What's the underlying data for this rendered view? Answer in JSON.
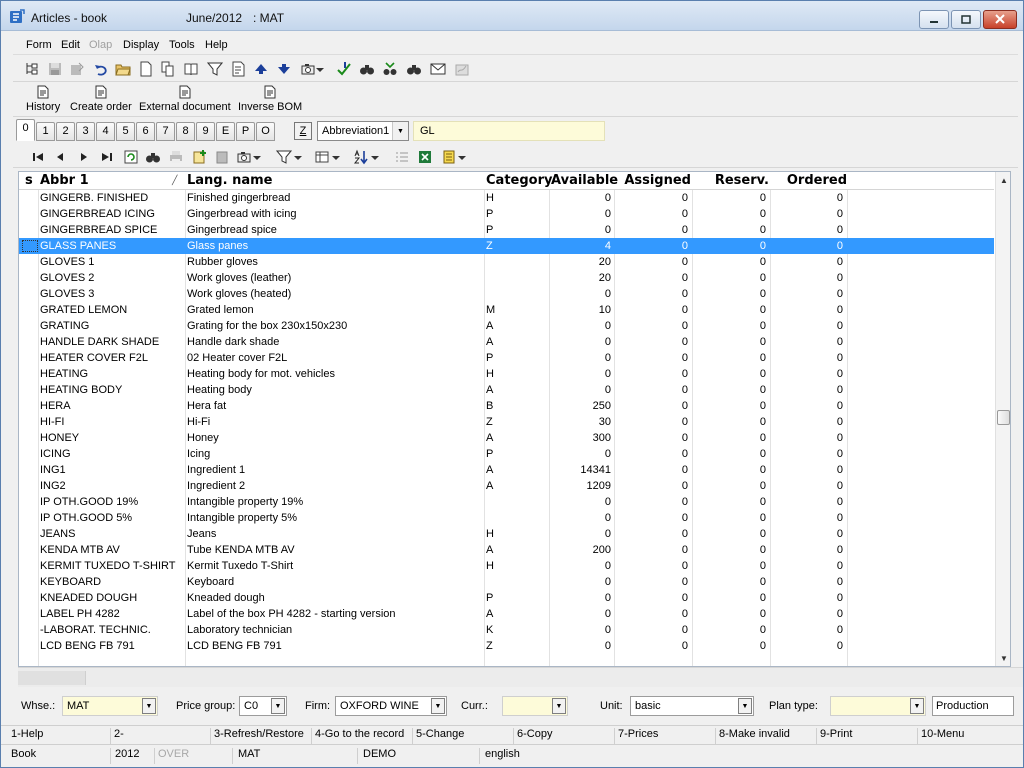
{
  "window": {
    "title": "Articles - book",
    "period": "June/2012",
    "code": ": MAT"
  },
  "menu": [
    {
      "label": "Form",
      "disabled": false
    },
    {
      "label": "Edit",
      "disabled": false
    },
    {
      "label": "Olap",
      "disabled": true
    },
    {
      "label": "Display",
      "disabled": false
    },
    {
      "label": "Tools",
      "disabled": false
    },
    {
      "label": "Help",
      "disabled": false
    }
  ],
  "toolbar_big": [
    {
      "label": "History"
    },
    {
      "label": "Create order"
    },
    {
      "label": "External document"
    },
    {
      "label": "Inverse BOM"
    }
  ],
  "tabs": [
    "0",
    "1",
    "2",
    "3",
    "4",
    "5",
    "6",
    "7",
    "8",
    "9",
    "E",
    "P",
    "O"
  ],
  "active_tab": "0",
  "sort": {
    "z_label": "Z",
    "field": "Abbreviation1",
    "search_value": "GL"
  },
  "grid": {
    "headers": {
      "s": "s",
      "abbr": "Abbr 1",
      "name": "Lang. name",
      "category": "Category",
      "available": "Available",
      "assigned": "Assigned",
      "reserv": "Reserv.",
      "ordered": "Ordered"
    },
    "selected_index": 3,
    "rows": [
      {
        "abbr": "GINGERB. FINISHED",
        "name": "Finished gingerbread",
        "category": "H",
        "available": "0",
        "assigned": "0",
        "reserv": "0",
        "ordered": "0"
      },
      {
        "abbr": "GINGERBREAD ICING",
        "name": "Gingerbread with icing",
        "category": "P",
        "available": "0",
        "assigned": "0",
        "reserv": "0",
        "ordered": "0"
      },
      {
        "abbr": "GINGERBREAD SPICE",
        "name": "Gingerbread spice",
        "category": "P",
        "available": "0",
        "assigned": "0",
        "reserv": "0",
        "ordered": "0"
      },
      {
        "abbr": "GLASS PANES",
        "name": "Glass panes",
        "category": "Z",
        "available": "4",
        "assigned": "0",
        "reserv": "0",
        "ordered": "0"
      },
      {
        "abbr": "GLOVES 1",
        "name": "Rubber gloves",
        "category": "",
        "available": "20",
        "assigned": "0",
        "reserv": "0",
        "ordered": "0"
      },
      {
        "abbr": "GLOVES 2",
        "name": "Work gloves (leather)",
        "category": "",
        "available": "20",
        "assigned": "0",
        "reserv": "0",
        "ordered": "0"
      },
      {
        "abbr": "GLOVES 3",
        "name": "Work gloves (heated)",
        "category": "",
        "available": "0",
        "assigned": "0",
        "reserv": "0",
        "ordered": "0"
      },
      {
        "abbr": "GRATED LEMON",
        "name": "Grated lemon",
        "category": "M",
        "available": "10",
        "assigned": "0",
        "reserv": "0",
        "ordered": "0"
      },
      {
        "abbr": "GRATING",
        "name": "Grating for the box 230x150x230",
        "category": "A",
        "available": "0",
        "assigned": "0",
        "reserv": "0",
        "ordered": "0"
      },
      {
        "abbr": "HANDLE DARK SHADE",
        "name": "Handle dark shade",
        "category": "A",
        "available": "0",
        "assigned": "0",
        "reserv": "0",
        "ordered": "0"
      },
      {
        "abbr": "HEATER COVER F2L",
        "name": "02 Heater cover F2L",
        "category": "P",
        "available": "0",
        "assigned": "0",
        "reserv": "0",
        "ordered": "0"
      },
      {
        "abbr": "HEATING",
        "name": "Heating body for mot. vehicles",
        "category": "H",
        "available": "0",
        "assigned": "0",
        "reserv": "0",
        "ordered": "0"
      },
      {
        "abbr": "HEATING BODY",
        "name": "Heating body",
        "category": "A",
        "available": "0",
        "assigned": "0",
        "reserv": "0",
        "ordered": "0"
      },
      {
        "abbr": "HERA",
        "name": "Hera fat",
        "category": "B",
        "available": "250",
        "assigned": "0",
        "reserv": "0",
        "ordered": "0"
      },
      {
        "abbr": "HI-FI",
        "name": "Hi-Fi",
        "category": "Z",
        "available": "30",
        "assigned": "0",
        "reserv": "0",
        "ordered": "0"
      },
      {
        "abbr": "HONEY",
        "name": "Honey",
        "category": "A",
        "available": "300",
        "assigned": "0",
        "reserv": "0",
        "ordered": "0"
      },
      {
        "abbr": "ICING",
        "name": "Icing",
        "category": "P",
        "available": "0",
        "assigned": "0",
        "reserv": "0",
        "ordered": "0"
      },
      {
        "abbr": "ING1",
        "name": "Ingredient 1",
        "category": "A",
        "available": "14341",
        "assigned": "0",
        "reserv": "0",
        "ordered": "0"
      },
      {
        "abbr": "ING2",
        "name": "Ingredient 2",
        "category": "A",
        "available": "1209",
        "assigned": "0",
        "reserv": "0",
        "ordered": "0"
      },
      {
        "abbr": "IP OTH.GOOD 19%",
        "name": "Intangible property 19%",
        "category": "",
        "available": "0",
        "assigned": "0",
        "reserv": "0",
        "ordered": "0"
      },
      {
        "abbr": "IP OTH.GOOD 5%",
        "name": "Intangible property 5%",
        "category": "",
        "available": "0",
        "assigned": "0",
        "reserv": "0",
        "ordered": "0"
      },
      {
        "abbr": "JEANS",
        "name": "Jeans",
        "category": "H",
        "available": "0",
        "assigned": "0",
        "reserv": "0",
        "ordered": "0"
      },
      {
        "abbr": "KENDA MTB AV",
        "name": "Tube KENDA MTB AV",
        "category": "A",
        "available": "200",
        "assigned": "0",
        "reserv": "0",
        "ordered": "0"
      },
      {
        "abbr": "KERMIT TUXEDO T-SHIRT",
        "name": "Kermit Tuxedo T-Shirt",
        "category": "H",
        "available": "0",
        "assigned": "0",
        "reserv": "0",
        "ordered": "0"
      },
      {
        "abbr": "KEYBOARD",
        "name": "Keyboard",
        "category": "",
        "available": "0",
        "assigned": "0",
        "reserv": "0",
        "ordered": "0"
      },
      {
        "abbr": "KNEADED DOUGH",
        "name": "Kneaded dough",
        "category": "P",
        "available": "0",
        "assigned": "0",
        "reserv": "0",
        "ordered": "0"
      },
      {
        "abbr": "LABEL PH 4282",
        "name": "Label of the box PH 4282 - starting version",
        "category": "A",
        "available": "0",
        "assigned": "0",
        "reserv": "0",
        "ordered": "0"
      },
      {
        "abbr": "-LABORAT. TECHNIC.",
        "name": "Laboratory technician",
        "category": "K",
        "available": "0",
        "assigned": "0",
        "reserv": "0",
        "ordered": "0"
      },
      {
        "abbr": "LCD BENG FB 791",
        "name": "LCD BENG FB 791",
        "category": "Z",
        "available": "0",
        "assigned": "0",
        "reserv": "0",
        "ordered": "0"
      }
    ]
  },
  "filters": {
    "whse_label": "Whse.:",
    "whse_value": "MAT",
    "price_group_label": "Price group:",
    "price_group_value": "C0",
    "firm_label": "Firm:",
    "firm_value": "OXFORD WINE",
    "curr_label": "Curr.:",
    "curr_value": "",
    "unit_label": "Unit:",
    "unit_value": "basic",
    "plan_type_label": "Plan type:",
    "plan_type_value": "",
    "production_value": "Production"
  },
  "function_keys": [
    "1-Help",
    "2-",
    "3-Refresh/Restore",
    "4-Go to the record",
    "5-Change",
    "6-Copy",
    "7-Prices",
    "8-Make invalid",
    "9-Print",
    "10-Menu"
  ],
  "status": {
    "book": "Book",
    "year": "2012",
    "over": "OVER",
    "warehouse": "MAT",
    "database": "DEMO",
    "language": "english"
  },
  "colors": {
    "selection": "#3399ff",
    "highlight_field": "#fdfbd9"
  }
}
